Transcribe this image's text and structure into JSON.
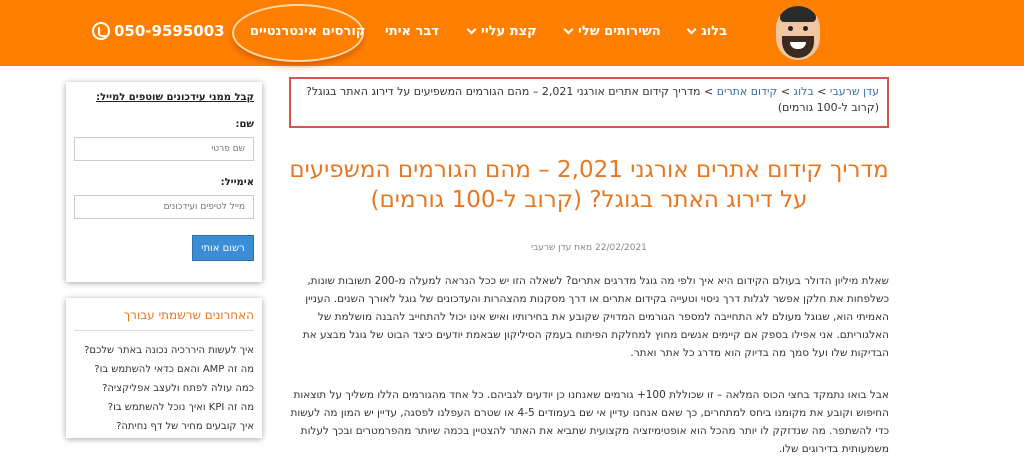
{
  "header": {
    "nav": {
      "blog": "בלוג",
      "services": "השירותים שלי",
      "about": "קצת עליי",
      "contact": "דבר איתי",
      "courses": "קורסים אינטרנטיים"
    },
    "phone": "050-9595003",
    "accent": "#ff7f00"
  },
  "breadcrumb": {
    "home": "עדן שרעבי",
    "blog": "בלוג",
    "category": "קידום אתרים",
    "current": "מדריך קידום אתרים אורגני 2,021 – מהם הגורמים המשפיעים על דירוג האתר בגוגל? (קרוב ל-100 גורמים)"
  },
  "article": {
    "title": "מדריך קידום אתרים אורגני 2,021 – מהם הגורמים המשפיעים על דירוג האתר בגוגל? (קרוב ל-100 גורמים)",
    "meta": "22/02/2021 מאת עדן שרעבי",
    "paragraph1": "שאלת מיליון הדולר בעולם הקידום היא איך ולפי מה גוגל מדרגים אתרים? לשאלה הזו יש ככל הנראה למעלה מ-200 תשובות שונות, כשלפחות את חלקן אפשר לגלות דרך ניסוי וטעייה בקידום אתרים או דרך מסקנות מהצהרות והעדכונים של גוגל לאורך השנים. העניין האמיתי הוא, שגוגל מעולם לא התחייבה למספר הגורמים המדויק שקובע את בחירותיו ואיש אינו יכול להתחייב להבנה מושלמת של האלגוריתם. אני אפילו בספק אם קיימים אנשים מחוץ למחלקת הפיתוח בעמק הסיליקון שבאמת יודעים כיצד הבוט של גוגל מבצע את הבדיקות שלו ועל סמך מה בדיוק הוא מדרג כל אתר ואתר.",
    "paragraph2": "אבל בואו נתמקד בחצי הכוס המלאה – זו שכוללת 100+ גורמים שאנחנו כן יודעים לגביהם. כל אחד מהגורמים הללו משליך על תוצאות החיפוש וקובע את מקומנו ביחס למתחרים, כך שאם אנחנו עדיין אי שם בעמודים 4-5 או שטרם העפלנו לפסגה, עדיין יש המון מה לעשות כדי להשתפר. מה שנדזקק לו יותר מהכל הוא אופטימיזציה מקצועית שתביא את האתר להצטיין בכמה שיותר מהפרמטרים ובכך לעלות משמעותית בדירוגים שלו."
  },
  "newsletter": {
    "title": "קבל ממני עידכונים שוטפים למייל:",
    "name_label": "שם:",
    "name_placeholder": "שם פרטי",
    "email_label": "אימייל:",
    "email_placeholder": "מייל לטיפים ועידכונים",
    "submit": "רשום אותי"
  },
  "recent": {
    "title": "האחרונים שרשמתי עבורך",
    "items": [
      "איך לעשות היררכיה נכונה באתר שלכם?",
      "מה זה AMP והאם כדאי להשתמש בו?",
      "כמה עולה לפתח ולעצב אפליקציה?",
      "מה זה KPI ואיך נוכל להשתמש בו?",
      "איך קובעים מחיר של דף נחיתה?"
    ]
  }
}
